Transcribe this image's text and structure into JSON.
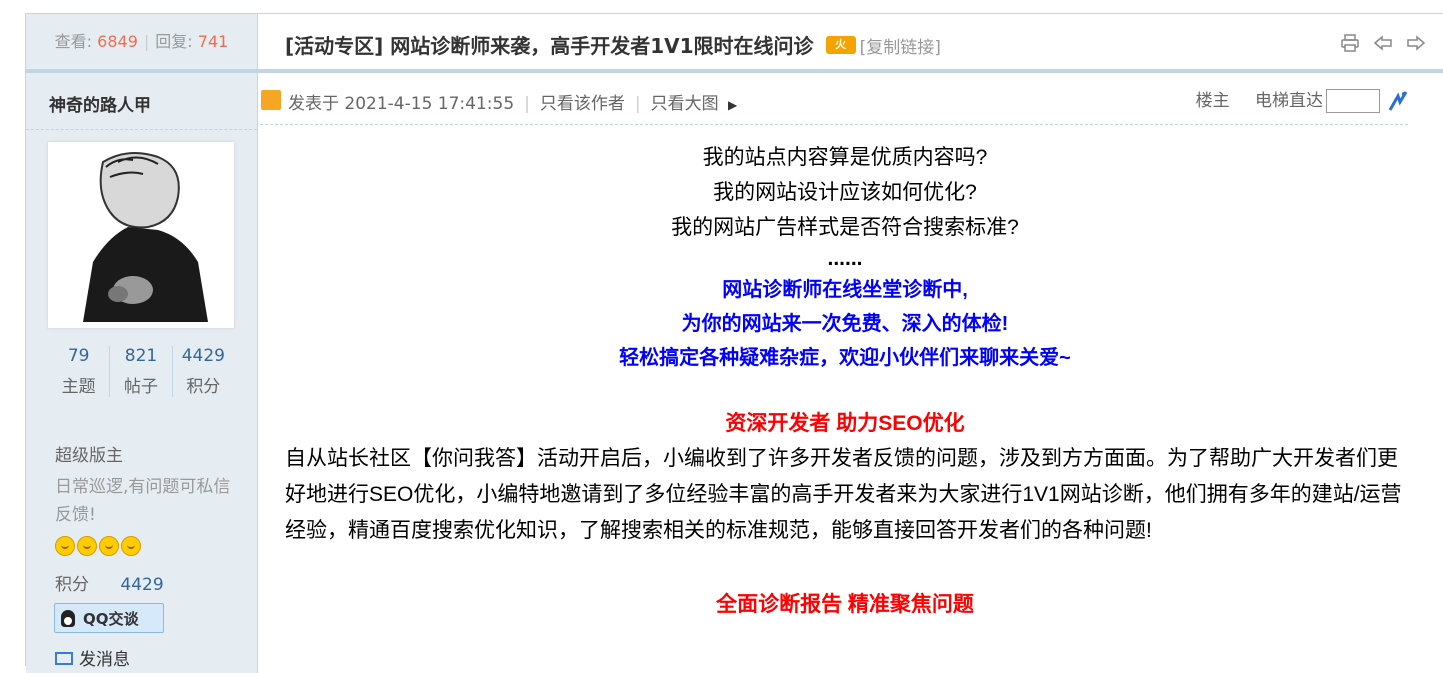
{
  "header": {
    "views_label": "查看:",
    "views": "6849",
    "replies_label": "回复:",
    "replies": "741",
    "title": "[活动专区] 网站诊断师来袭，高手开发者1V1限时在线问诊",
    "hot_badge": "火",
    "copy_link": "[复制链接]",
    "tools": [
      "print-icon",
      "prev-icon",
      "next-icon"
    ]
  },
  "author": {
    "name": "神奇的路人甲",
    "stats": [
      {
        "value": "79",
        "label": "主题"
      },
      {
        "value": "821",
        "label": "帖子"
      },
      {
        "value": "4429",
        "label": "积分"
      }
    ],
    "group": "超级版主",
    "motto": "日常巡逻,有问题可私信反馈!",
    "stars": 4,
    "points_label": "积分",
    "points": "4429",
    "qq_label": "QQ交谈",
    "msg_label": "发消息"
  },
  "post_meta": {
    "posted_at": "发表于 2021-4-15 17:41:55",
    "only_author": "只看该作者",
    "only_images": "只看大图",
    "floor_label": "楼主",
    "jump_label": "电梯直达",
    "jump_value": ""
  },
  "content": {
    "q1": "我的站点内容算是优质内容吗?",
    "q2": "我的网站设计应该如何优化?",
    "q3": "我的网站广告样式是否符合搜索标准?",
    "ellipsis": "......",
    "b1": "网站诊断师在线坐堂诊断中,",
    "b2": "为你的网站来一次免费、深入的体检!",
    "b3": "轻松搞定各种疑难杂症，欢迎小伙伴们来聊来关爱~",
    "heading1": "资深开发者  助力SEO优化",
    "paragraph": "自从站长社区【你问我答】活动开启后，小编收到了许多开发者反馈的问题，涉及到方方面面。为了帮助广大开发者们更好地进行SEO优化，小编特地邀请到了多位经验丰富的高手开发者来为大家进行1V1网站诊断，他们拥有多年的建站/运营经验，精通百度搜索优化知识，了解搜索相关的标准规范，能够直接回答开发者们的各种问题!",
    "heading2": "全面诊断报告 精准聚焦问题"
  },
  "colors": {
    "accent_orange": "#f26c4f",
    "sidebar_bg": "#e5edf2",
    "border": "#c2d5e3",
    "blue_text": "#0000ff",
    "red_text": "#ff0000"
  }
}
